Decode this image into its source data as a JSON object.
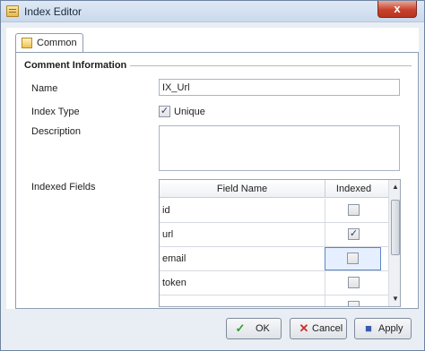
{
  "window": {
    "title": "Index Editor",
    "close_glyph": "x"
  },
  "tabs": [
    {
      "label": "Common",
      "icon": "page-icon"
    }
  ],
  "section": {
    "title": "Comment Information"
  },
  "form": {
    "name_label": "Name",
    "name_value": "IX_Url",
    "index_type_label": "Index Type",
    "unique_label": "Unique",
    "unique_checked": true,
    "description_label": "Description",
    "description_value": "",
    "indexed_fields_label": "Indexed Fields"
  },
  "grid": {
    "headers": [
      "Field Name",
      "Indexed"
    ],
    "rows": [
      {
        "name": "id",
        "indexed": false
      },
      {
        "name": "url",
        "indexed": true
      },
      {
        "name": "email",
        "indexed": false,
        "selected": true
      },
      {
        "name": "token",
        "indexed": false
      }
    ]
  },
  "buttons": {
    "ok": "OK",
    "cancel": "Cancel",
    "apply": "Apply"
  },
  "colors": {
    "ok_icon": "#2f9c2f",
    "cancel_icon": "#c8312a",
    "apply_icon": "#3b5bb0",
    "close": "#c7432c"
  }
}
